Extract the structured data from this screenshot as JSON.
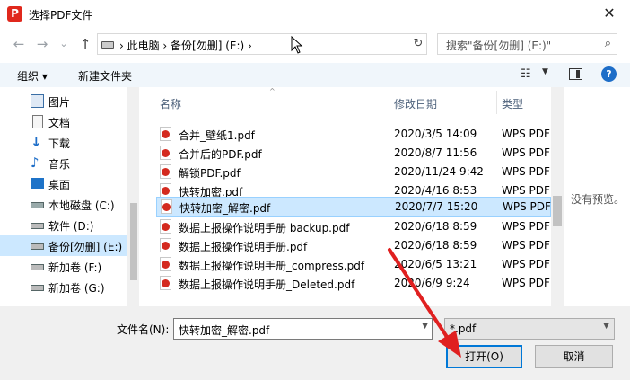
{
  "window": {
    "title": "选择PDF文件",
    "app_icon_letter": "P",
    "close_glyph": "✕"
  },
  "nav": {
    "back": "←",
    "forward": "→",
    "recent": "⌄",
    "up": "↑",
    "address": "›  此电脑  ›  备份[勿删] (E:)  ›",
    "refresh": "↻",
    "search_placeholder": "搜索\"备份[勿删] (E:)\""
  },
  "toolbar": {
    "organize": "组织 ▾",
    "new_folder": "新建文件夹",
    "view_drop": "▼",
    "help": "?"
  },
  "sidebar": {
    "items": [
      {
        "label": "图片",
        "icon": "pictures-icon"
      },
      {
        "label": "文档",
        "icon": "documents-icon"
      },
      {
        "label": "下载",
        "icon": "downloads-icon"
      },
      {
        "label": "音乐",
        "icon": "music-icon"
      },
      {
        "label": "桌面",
        "icon": "desktop-icon"
      },
      {
        "label": "本地磁盘 (C:)",
        "icon": "drive-icon"
      },
      {
        "label": "软件 (D:)",
        "icon": "drive-icon"
      },
      {
        "label": "备份[勿删] (E:)",
        "icon": "drive-icon",
        "selected": true
      },
      {
        "label": "新加卷 (F:)",
        "icon": "drive-icon"
      },
      {
        "label": "新加卷 (G:)",
        "icon": "drive-icon"
      }
    ]
  },
  "list": {
    "headers": {
      "name": "名称",
      "date": "修改日期",
      "type": "类型"
    },
    "rows": [
      {
        "name": "合并_壁纸1.pdf",
        "date": "2020/3/5 14:09",
        "type": "WPS PDF"
      },
      {
        "name": "合并后的PDF.pdf",
        "date": "2020/8/7 11:56",
        "type": "WPS PDF"
      },
      {
        "name": "解锁PDF.pdf",
        "date": "2020/11/24 9:42",
        "type": "WPS PDF"
      },
      {
        "name": "快转加密.pdf",
        "date": "2020/4/16 8:53",
        "type": "WPS PDF"
      },
      {
        "name": "快转加密_解密.pdf",
        "date": "2020/7/7 15:20",
        "type": "WPS PDF",
        "selected": true
      },
      {
        "name": "数据上报操作说明手册 backup.pdf",
        "date": "2020/6/18 8:59",
        "type": "WPS PDF"
      },
      {
        "name": "数据上报操作说明手册.pdf",
        "date": "2020/6/18 8:59",
        "type": "WPS PDF"
      },
      {
        "name": "数据上报操作说明手册_compress.pdf",
        "date": "2020/6/5 13:21",
        "type": "WPS PDF"
      },
      {
        "name": "数据上报操作说明手册_Deleted.pdf",
        "date": "2020/6/9 9:24",
        "type": "WPS PDF"
      }
    ]
  },
  "preview": {
    "text": "没有预览。"
  },
  "bottom": {
    "filename_label": "文件名(N):",
    "filename_value": "快转加密_解密.pdf",
    "filetype_value": "*.pdf",
    "open_label": "打开(O)",
    "cancel_label": "取消"
  },
  "colors": {
    "accent": "#0078d7",
    "selection": "#cce8ff",
    "annotation_arrow": "#e02020"
  }
}
